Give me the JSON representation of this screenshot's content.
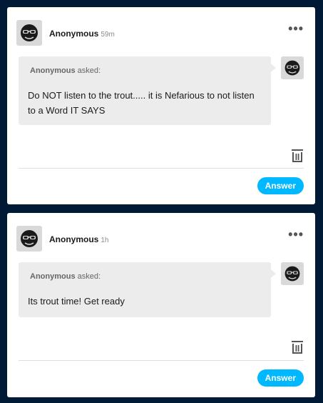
{
  "colors": {
    "page_background": "#001935",
    "accent": "#00b8ff",
    "card": "#ffffff",
    "bubble": "#ececec"
  },
  "icons": {
    "avatar": "sunglasses-avatar-icon",
    "more": "more-options-icon",
    "delete": "trash-icon"
  },
  "asks": [
    {
      "name": "Anonymous",
      "time": "59m",
      "more": "•••",
      "asker": "Anonymous",
      "asked_suffix": " asked:",
      "question": "Do NOT listen to the trout..... it is Nefarious to not listen to a Word IT SAYS",
      "answer_label": "Answer"
    },
    {
      "name": "Anonymous",
      "time": "1h",
      "more": "•••",
      "asker": "Anonymous",
      "asked_suffix": " asked:",
      "question": "Its trout time! Get ready",
      "answer_label": "Answer"
    }
  ]
}
